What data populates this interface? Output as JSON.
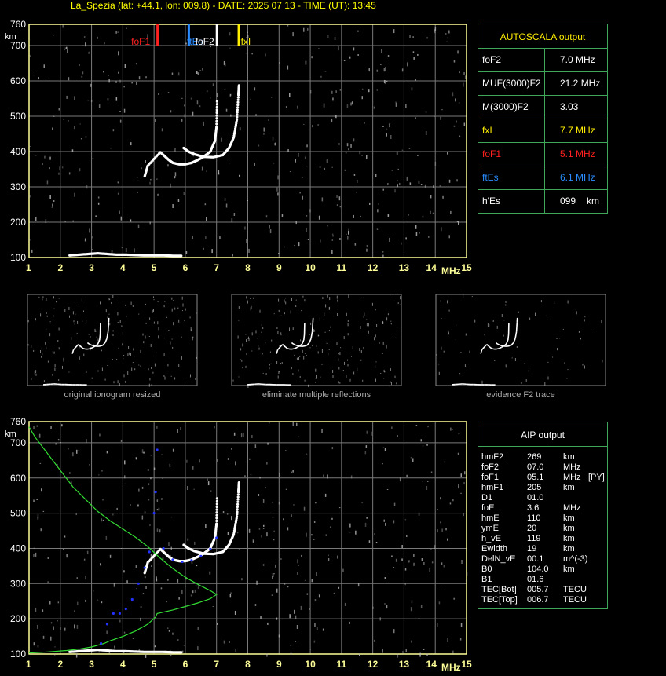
{
  "title": "La_Spezia (lat: +44.1, lon: 009.8) - DATE: 2025 07 13 - TIME (UT): 13:45",
  "colors": {
    "axis": "#ffff99",
    "grid": "#7a7a7a",
    "panel_border": "#3fa65a",
    "profile": "#33dd33",
    "trace_fit": "#2233ff",
    "foF1": "#ff2020",
    "ftEs": "#2a8cff",
    "foF2": "#ffffff",
    "fxI": "#ffee00"
  },
  "markers": [
    {
      "label": "foF1",
      "freq": 5.1,
      "color": "#ff2020"
    },
    {
      "label": "ftEs",
      "freq": 6.1,
      "color": "#2a8cff"
    },
    {
      "label": "foF2",
      "freq": 7.0,
      "color": "#ffffff"
    },
    {
      "label": "fxI",
      "freq": 7.7,
      "color": "#ffee00"
    }
  ],
  "autoscala": {
    "header": "AUTOSCALA output",
    "rows": [
      {
        "label": "foF2",
        "value": "7.0 MHz",
        "color": "#ffffff"
      },
      {
        "label": "MUF(3000)F2",
        "value": "21.2 MHz",
        "color": "#ffffff"
      },
      {
        "label": "M(3000)F2",
        "value": "3.03",
        "color": "#ffffff"
      },
      {
        "label": "fxI",
        "value": "7.7 MHz",
        "color": "#ffee00"
      },
      {
        "label": "foF1",
        "value": "5.1 MHz",
        "color": "#ff2020"
      },
      {
        "label": "ftEs",
        "value": "6.1 MHz",
        "color": "#2a8cff"
      },
      {
        "label": "h'Es",
        "value": "099",
        "unit": "km",
        "color": "#ffffff"
      }
    ]
  },
  "thumbnails": [
    {
      "caption": "original ionogram resized"
    },
    {
      "caption": "eliminate multiple reflections"
    },
    {
      "caption": "evidence F2 trace"
    }
  ],
  "aip": {
    "header": "AIP output",
    "rows": [
      {
        "label": "hmF2",
        "value": "269",
        "unit": "km",
        "extra": ""
      },
      {
        "label": "foF2",
        "value": "07.0",
        "unit": "MHz",
        "extra": ""
      },
      {
        "label": "foF1",
        "value": "05.1",
        "unit": "MHz",
        "extra": "[PY]"
      },
      {
        "label": "hmF1",
        "value": "205",
        "unit": "km",
        "extra": ""
      },
      {
        "label": "D1",
        "value": "01.0",
        "unit": "",
        "extra": ""
      },
      {
        "label": "foE",
        "value": "3.6",
        "unit": "MHz",
        "extra": ""
      },
      {
        "label": "hmE",
        "value": "110",
        "unit": "km",
        "extra": ""
      },
      {
        "label": "ymE",
        "value": "20",
        "unit": "km",
        "extra": ""
      },
      {
        "label": "h_vE",
        "value": "119",
        "unit": "km",
        "extra": ""
      },
      {
        "label": "Ewidth",
        "value": "19",
        "unit": "km",
        "extra": ""
      },
      {
        "label": "DelN_vE",
        "value": "00.1",
        "unit": "m^(-3)",
        "extra": ""
      },
      {
        "label": "B0",
        "value": "104.0",
        "unit": "km",
        "extra": ""
      },
      {
        "label": "B1",
        "value": "01.6",
        "unit": "",
        "extra": ""
      },
      {
        "label": "TEC[Bot]",
        "value": "005.7",
        "unit": "TECU",
        "extra": ""
      },
      {
        "label": "TEC[Top]",
        "value": "006.7",
        "unit": "TECU",
        "extra": ""
      }
    ]
  },
  "chart_data": [
    {
      "type": "scatter",
      "name": "ionogram_autoscala",
      "xlabel": "MHz",
      "ylabel": "km",
      "xlim": [
        1,
        15
      ],
      "ylim": [
        100,
        760
      ],
      "x_ticks": [
        1,
        2,
        3,
        4,
        5,
        6,
        7,
        8,
        9,
        10,
        11,
        12,
        13,
        14,
        15
      ],
      "y_ticks": [
        100,
        200,
        300,
        400,
        500,
        600,
        700,
        760
      ],
      "grid": true,
      "traces": [
        {
          "name": "Es",
          "points": [
            [
              2.3,
              106
            ],
            [
              2.6,
              108
            ],
            [
              2.9,
              110
            ],
            [
              3.2,
              112
            ],
            [
              3.5,
              110
            ],
            [
              3.8,
              108
            ],
            [
              4.1,
              108
            ],
            [
              4.4,
              107
            ],
            [
              4.7,
              106
            ],
            [
              5.0,
              106
            ],
            [
              5.3,
              106
            ],
            [
              5.6,
              105
            ],
            [
              5.9,
              105
            ]
          ]
        },
        {
          "name": "F2 ordinary",
          "points": [
            [
              4.7,
              330
            ],
            [
              4.8,
              360
            ],
            [
              5.2,
              398
            ],
            [
              5.45,
              378
            ],
            [
              5.6,
              368
            ],
            [
              5.8,
              364
            ],
            [
              6.0,
              364
            ],
            [
              6.2,
              368
            ],
            [
              6.4,
              376
            ],
            [
              6.6,
              386
            ],
            [
              6.8,
              400
            ],
            [
              6.95,
              430
            ],
            [
              7.0,
              470
            ],
            [
              7.02,
              550
            ]
          ]
        },
        {
          "name": "F2 extraordinary",
          "points": [
            [
              5.95,
              410
            ],
            [
              6.1,
              400
            ],
            [
              6.3,
              392
            ],
            [
              6.6,
              385
            ],
            [
              6.9,
              384
            ],
            [
              7.2,
              390
            ],
            [
              7.4,
              410
            ],
            [
              7.55,
              440
            ],
            [
              7.65,
              490
            ],
            [
              7.7,
              560
            ],
            [
              7.72,
              590
            ]
          ]
        }
      ]
    },
    {
      "type": "scatter",
      "name": "ionogram_aip",
      "xlabel": "MHz",
      "ylabel": "km",
      "xlim": [
        1,
        15
      ],
      "ylim": [
        100,
        760
      ],
      "x_ticks": [
        1,
        2,
        3,
        4,
        5,
        6,
        7,
        8,
        9,
        10,
        11,
        12,
        13,
        14,
        15
      ],
      "y_ticks": [
        100,
        200,
        300,
        400,
        500,
        600,
        700,
        760
      ],
      "grid": true,
      "profile": [
        [
          1.0,
          745
        ],
        [
          1.2,
          715
        ],
        [
          1.5,
          680
        ],
        [
          1.8,
          645
        ],
        [
          2.1,
          610
        ],
        [
          2.4,
          575
        ],
        [
          2.8,
          540
        ],
        [
          3.2,
          505
        ],
        [
          3.6,
          478
        ],
        [
          4.0,
          455
        ],
        [
          4.4,
          432
        ],
        [
          4.8,
          405
        ],
        [
          5.2,
          372
        ],
        [
          5.6,
          343
        ],
        [
          6.0,
          318
        ],
        [
          6.4,
          298
        ],
        [
          6.8,
          280
        ],
        [
          7.0,
          269
        ],
        [
          6.8,
          257
        ],
        [
          6.4,
          245
        ],
        [
          6.0,
          235
        ],
        [
          5.6,
          225
        ],
        [
          5.1,
          215
        ],
        [
          5.05,
          205
        ],
        [
          4.8,
          185
        ],
        [
          4.4,
          165
        ],
        [
          4.0,
          150
        ],
        [
          3.6,
          138
        ],
        [
          3.4,
          130
        ],
        [
          3.0,
          120
        ],
        [
          2.6,
          114
        ],
        [
          2.2,
          110
        ],
        [
          1.6,
          106
        ],
        [
          1.0,
          103
        ]
      ],
      "fit_trace": [
        [
          3.3,
          130
        ],
        [
          3.5,
          185
        ],
        [
          3.7,
          215
        ],
        [
          3.9,
          215
        ],
        [
          4.1,
          228
        ],
        [
          4.3,
          255
        ],
        [
          4.5,
          300
        ],
        [
          4.7,
          345
        ],
        [
          4.85,
          390
        ],
        [
          5.0,
          500
        ],
        [
          5.05,
          560
        ],
        [
          5.1,
          680
        ],
        [
          5.3,
          400
        ],
        [
          5.6,
          368
        ],
        [
          5.9,
          362
        ],
        [
          6.2,
          366
        ],
        [
          6.5,
          378
        ],
        [
          6.8,
          398
        ],
        [
          7.0,
          430
        ]
      ]
    }
  ]
}
